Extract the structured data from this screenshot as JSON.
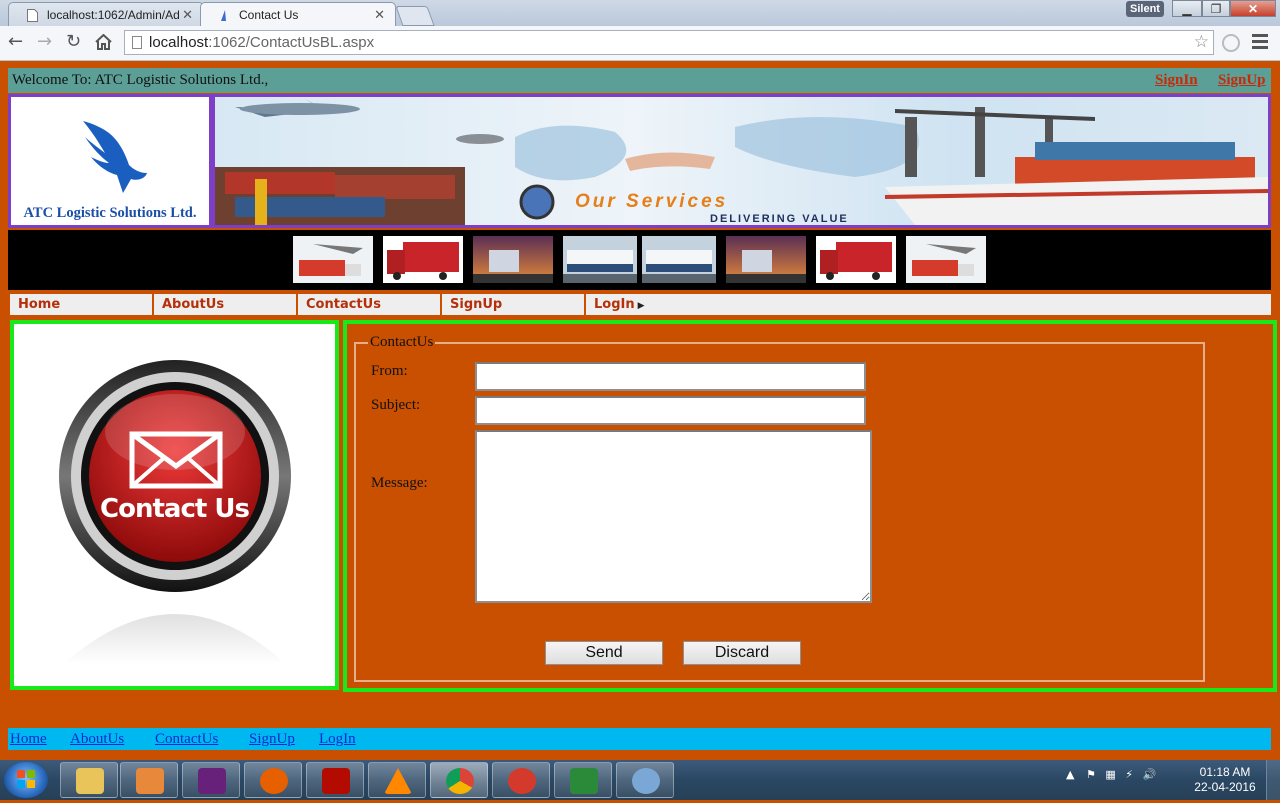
{
  "browser": {
    "tabs": [
      {
        "title": "localhost:1062/Admin/Ad"
      },
      {
        "title": "Contact Us"
      }
    ],
    "silent_badge": "Silent",
    "address": {
      "host": "localhost",
      "path": ":1062/ContactUsBL.aspx"
    }
  },
  "header": {
    "welcome_text": "Welcome To: ATC Logistic Solutions Ltd.,",
    "signin_label": "SignIn",
    "signup_label": "SignUp"
  },
  "logo": {
    "company_name": "ATC Logistic Solutions Ltd."
  },
  "banner": {
    "headline": "Our Services",
    "tagline": "DELIVERING VALUE"
  },
  "thumbnails": [
    "plane-truck",
    "red-truck",
    "sunset-truck",
    "white-trucks",
    "white-trucks",
    "sunset-truck",
    "red-truck",
    "plane-truck"
  ],
  "nav": {
    "items": [
      "Home",
      "AboutUs",
      "ContactUs",
      "SignUp",
      "LogIn"
    ]
  },
  "contact_image": {
    "text": "Contact Us"
  },
  "form": {
    "legend": "ContactUs",
    "from_label": "From:",
    "subject_label": "Subject:",
    "message_label": "Message:",
    "from_value": "",
    "subject_value": "",
    "message_value": "",
    "send_label": "Send",
    "discard_label": "Discard"
  },
  "footer": {
    "links": [
      "Home",
      "AboutUs",
      "ContactUs",
      "SignUp",
      "LogIn"
    ]
  },
  "taskbar": {
    "apps": [
      "windows-explorer",
      "media-player",
      "visual-studio",
      "firefox",
      "acrobat",
      "vlc",
      "chrome",
      "ccleaner",
      "sd-app",
      "paint"
    ],
    "clock_time": "01:18 AM",
    "clock_date": "22-04-2016"
  },
  "colors": {
    "page_background": "#c85000",
    "panel_border": "#19e819",
    "welcome_bar": "#5b9f97",
    "footer_bar": "#00b8f0",
    "banner_border": "#7e3fc7"
  }
}
